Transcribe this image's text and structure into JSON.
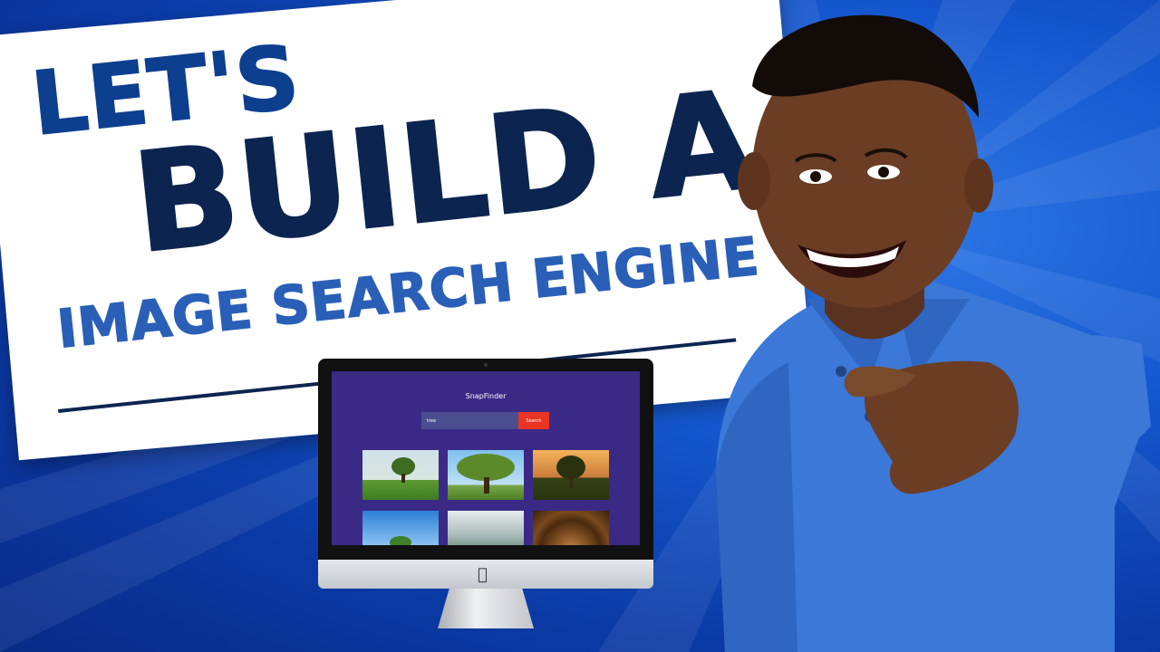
{
  "headline": {
    "line1": "LET'S",
    "line2": "BUILD A",
    "line3": "IMAGE SEARCH ENGINE"
  },
  "app": {
    "title": "SnapFinder",
    "search_value": "tree",
    "search_button": "Search"
  },
  "colors": {
    "background": "#1557cf",
    "card": "#ffffff",
    "headline_dark": "#0c2550",
    "headline_mid": "#0d3f8f",
    "headline_light": "#2a5fb8",
    "screen_bg": "#3a2a86",
    "search_button": "#e93424"
  },
  "icons": {
    "monitor_logo": "apple-logo-icon"
  }
}
